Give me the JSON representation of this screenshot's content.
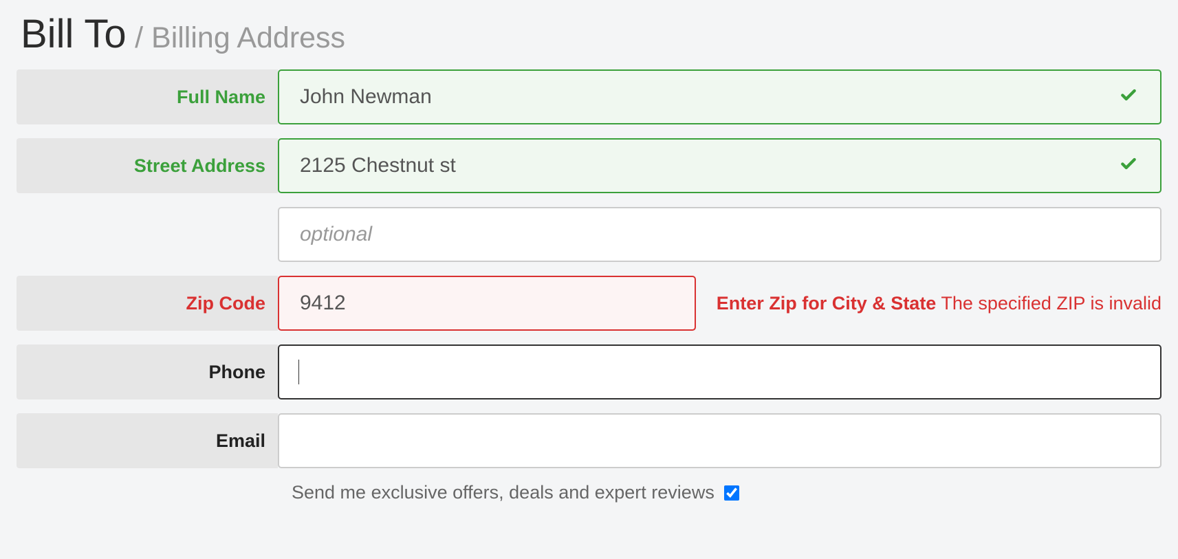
{
  "header": {
    "title": "Bill To",
    "subtitle": "/ Billing Address"
  },
  "form": {
    "full_name": {
      "label": "Full Name",
      "value": "John Newman"
    },
    "street_address": {
      "label": "Street Address",
      "value": "2125 Chestnut st"
    },
    "street_address_2": {
      "placeholder": "optional",
      "value": ""
    },
    "zip_code": {
      "label": "Zip Code",
      "value": "9412",
      "hint": "Enter Zip for City & State",
      "error_msg": "The specified ZIP is invalid"
    },
    "phone": {
      "label": "Phone",
      "value": ""
    },
    "email": {
      "label": "Email",
      "value": ""
    },
    "offers_checkbox": {
      "label": "Send me exclusive offers, deals and expert reviews",
      "checked": true
    }
  }
}
